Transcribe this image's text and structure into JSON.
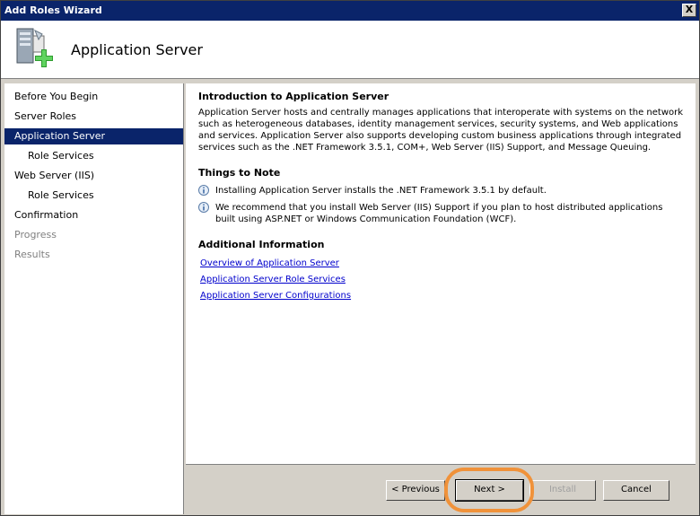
{
  "window": {
    "title": "Add Roles Wizard",
    "close_label": "X"
  },
  "header": {
    "title": "Application Server"
  },
  "sidebar": {
    "items": [
      {
        "label": "Before You Begin"
      },
      {
        "label": "Server Roles"
      },
      {
        "label": "Application Server"
      },
      {
        "label": "Role Services"
      },
      {
        "label": "Web Server (IIS)"
      },
      {
        "label": "Role Services"
      },
      {
        "label": "Confirmation"
      },
      {
        "label": "Progress"
      },
      {
        "label": "Results"
      }
    ]
  },
  "content": {
    "intro_heading": "Introduction to Application Server",
    "intro_text": "Application Server hosts and centrally manages applications that interoperate with systems on the network such as heterogeneous databases, identity management services, security systems, and Web applications and services. Application Server also supports developing custom business applications through integrated services such as the .NET Framework 3.5.1, COM+, Web Server (IIS) Support, and Message Queuing.",
    "notes_heading": "Things to Note",
    "notes": [
      "Installing Application Server installs the .NET Framework 3.5.1 by default.",
      "We recommend that you install Web Server (IIS) Support if you plan to host distributed applications built using ASP.NET or Windows Communication Foundation (WCF)."
    ],
    "additional_heading": "Additional Information",
    "links": [
      "Overview of Application Server",
      "Application Server Role Services",
      "Application Server Configurations"
    ]
  },
  "footer": {
    "previous_label": "< Previous",
    "next_label": "Next >",
    "install_label": "Install",
    "cancel_label": "Cancel"
  },
  "colors": {
    "title_bar": "#0a246a",
    "selected_nav": "#0a246a",
    "link": "#0000cc",
    "highlight_ring": "#f0923a"
  }
}
